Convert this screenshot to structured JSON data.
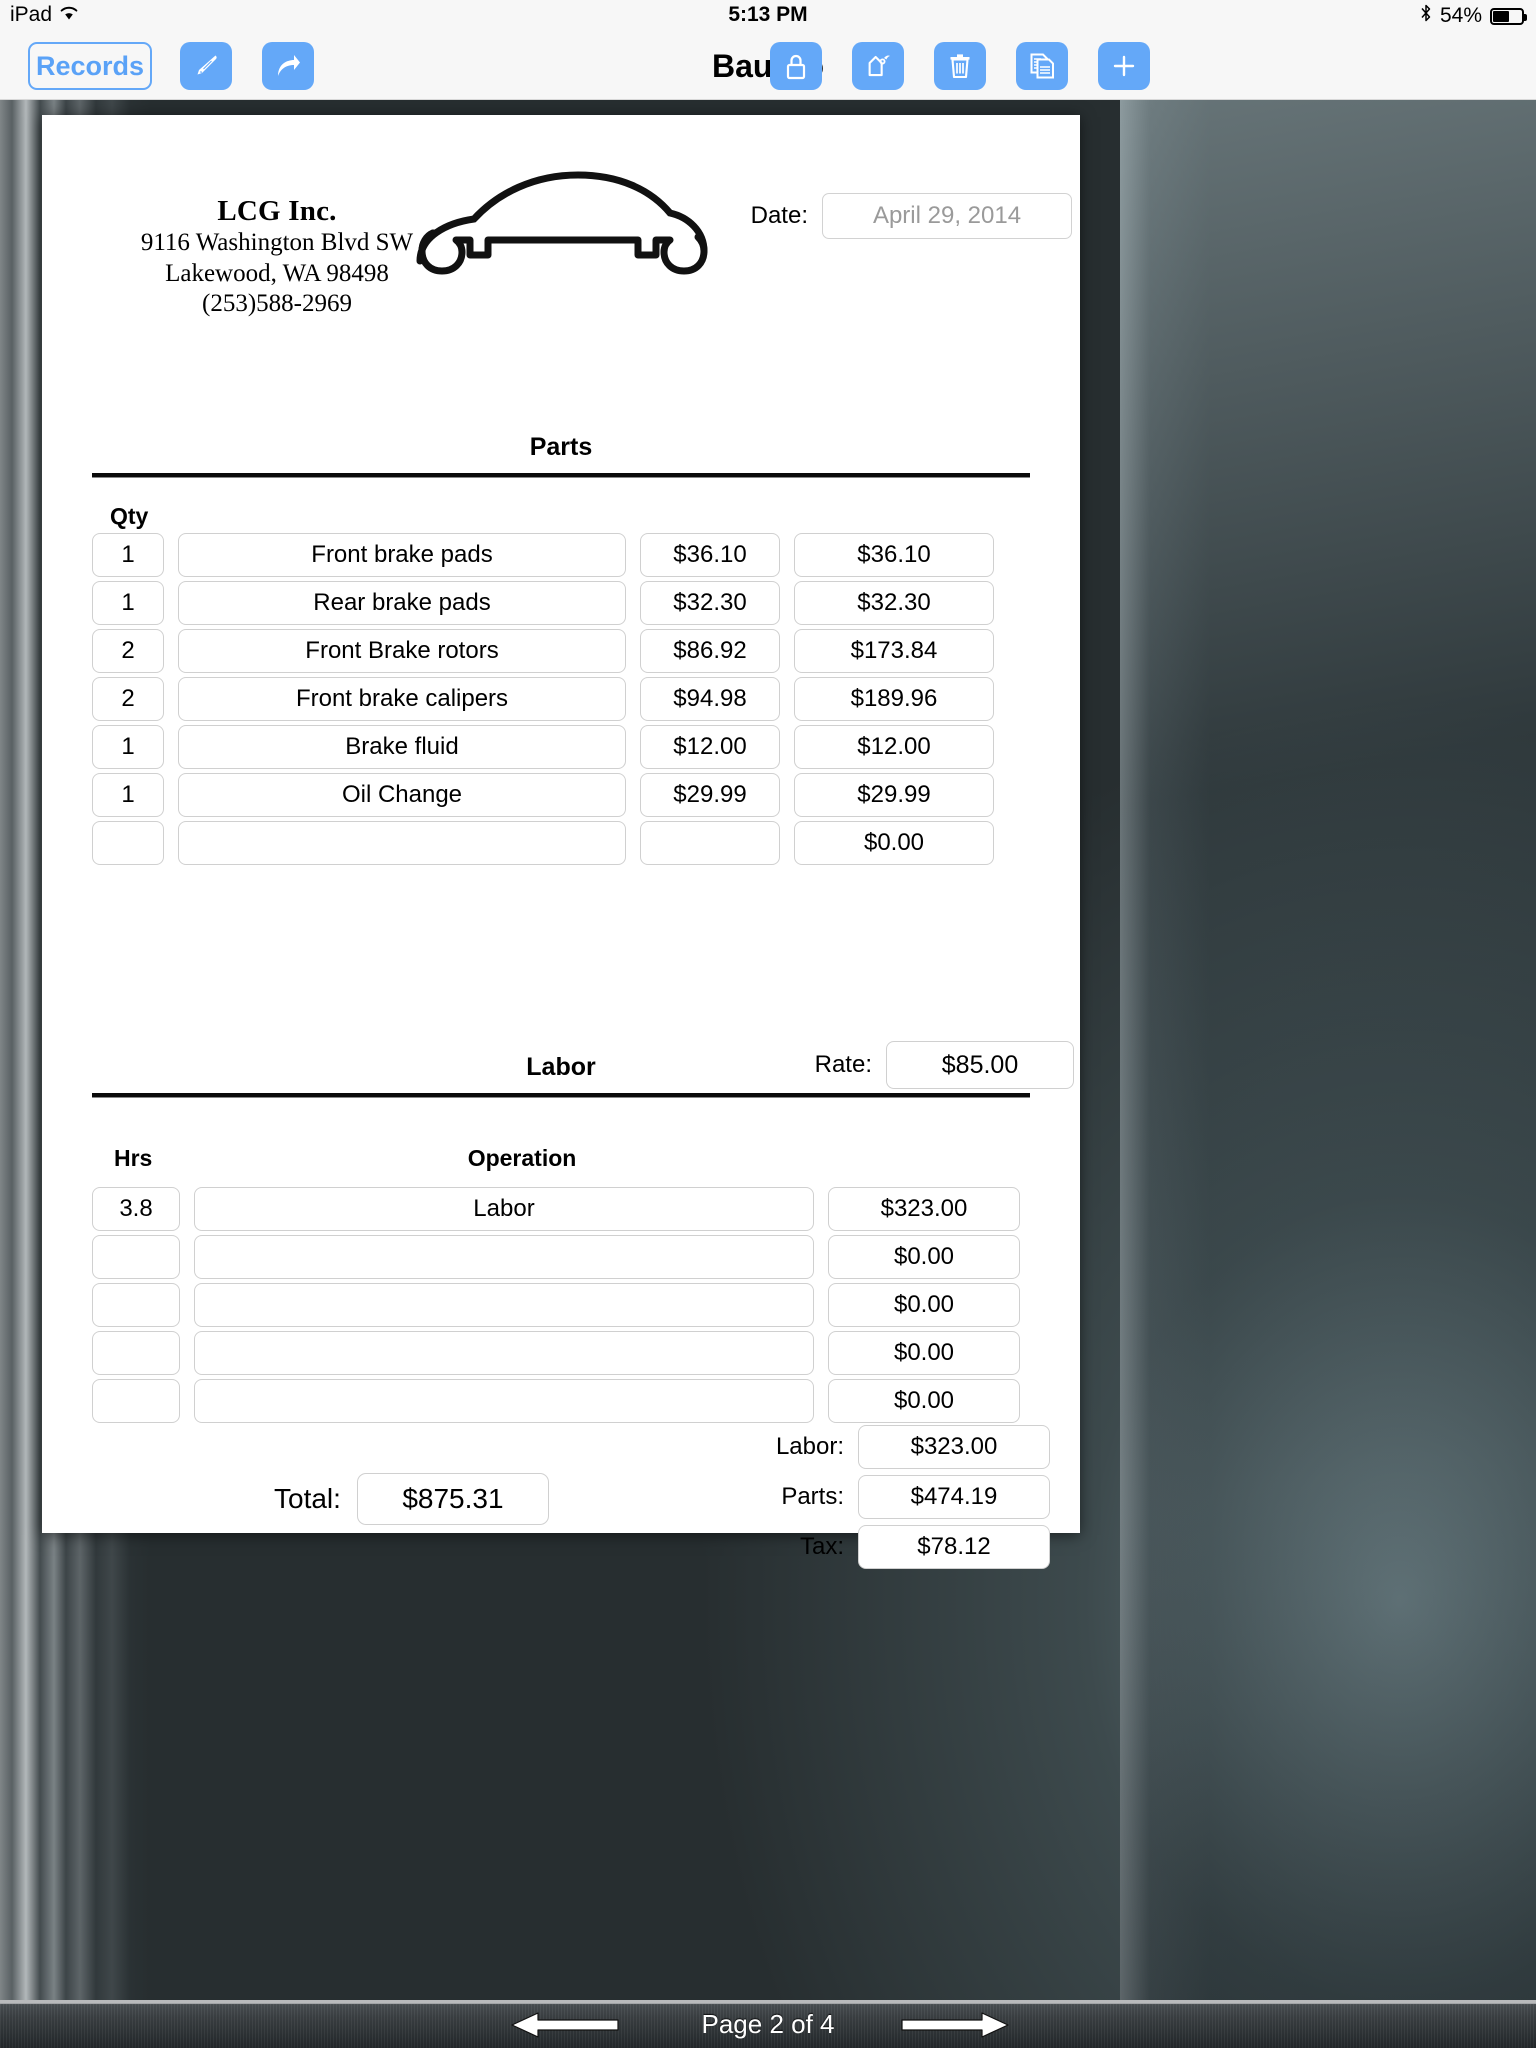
{
  "status_bar": {
    "device": "iPad",
    "wifi_icon": "wifi-icon",
    "time": "5:13 PM",
    "bluetooth_icon": "bluetooth-icon",
    "battery_percent": "54%"
  },
  "toolbar": {
    "records_label": "Records",
    "title": "Bau Ho",
    "left_icons": [
      {
        "name": "pen-icon"
      },
      {
        "name": "share-icon"
      }
    ],
    "right_icons": [
      {
        "name": "lock-icon"
      },
      {
        "name": "tag-icon"
      },
      {
        "name": "trash-icon"
      },
      {
        "name": "duplicate-icon"
      },
      {
        "name": "add-icon"
      }
    ],
    "accent_color": "#64a8f8"
  },
  "document": {
    "company": {
      "name": "LCG Inc.",
      "address_line1": "9116 Washington Blvd SW",
      "address_line2": "Lakewood, WA  98498",
      "phone": "(253)588-2969"
    },
    "logo_icon": "car-wrench-logo-icon",
    "date": {
      "label": "Date:",
      "value": "April 29, 2014"
    },
    "parts": {
      "section_title": "Parts",
      "qty_header": "Qty",
      "rows": [
        {
          "qty": "1",
          "description": "Front brake pads",
          "price": "$36.10",
          "extended": "$36.10"
        },
        {
          "qty": "1",
          "description": "Rear brake pads",
          "price": "$32.30",
          "extended": "$32.30"
        },
        {
          "qty": "2",
          "description": "Front Brake rotors",
          "price": "$86.92",
          "extended": "$173.84"
        },
        {
          "qty": "2",
          "description": "Front brake calipers",
          "price": "$94.98",
          "extended": "$189.96"
        },
        {
          "qty": "1",
          "description": "Brake fluid",
          "price": "$12.00",
          "extended": "$12.00"
        },
        {
          "qty": "1",
          "description": "Oil Change",
          "price": "$29.99",
          "extended": "$29.99"
        },
        {
          "qty": "",
          "description": "",
          "price": "",
          "extended": "$0.00"
        }
      ]
    },
    "labor": {
      "section_title": "Labor",
      "rate_label": "Rate:",
      "rate_value": "$85.00",
      "hrs_header": "Hrs",
      "operation_header": "Operation",
      "rows": [
        {
          "hrs": "3.8",
          "operation": "Labor",
          "amount": "$323.00"
        },
        {
          "hrs": "",
          "operation": "",
          "amount": "$0.00"
        },
        {
          "hrs": "",
          "operation": "",
          "amount": "$0.00"
        },
        {
          "hrs": "",
          "operation": "",
          "amount": "$0.00"
        },
        {
          "hrs": "",
          "operation": "",
          "amount": "$0.00"
        }
      ]
    },
    "totals": {
      "labor_label": "Labor:",
      "labor_value": "$323.00",
      "parts_label": "Parts:",
      "parts_value": "$474.19",
      "tax_label": "Tax:",
      "tax_value": "$78.12",
      "total_label": "Total:",
      "total_value": "$875.31"
    }
  },
  "pagebar": {
    "indicator": "Page 2 of 4",
    "prev_icon": "left-arrow-icon",
    "next_icon": "right-arrow-icon"
  }
}
